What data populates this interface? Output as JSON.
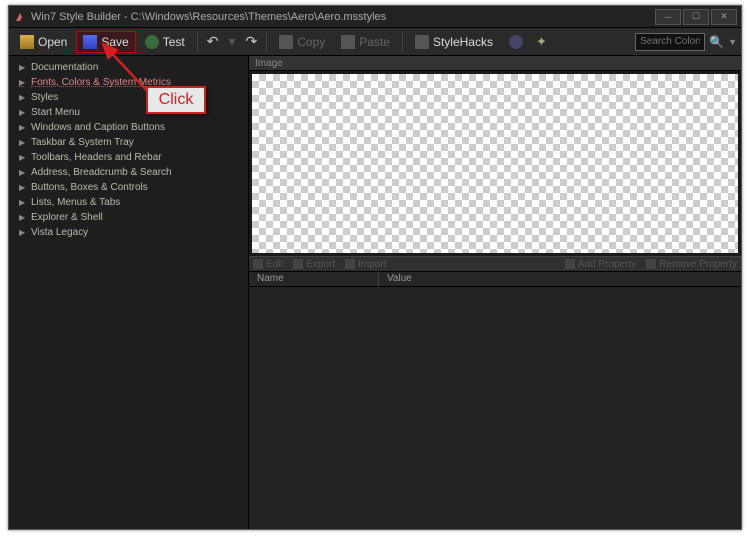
{
  "window": {
    "title": "Win7 Style Builder - C:\\Windows\\Resources\\Themes\\Aero\\Aero.msstyles"
  },
  "toolbar": {
    "open": "Open",
    "save": "Save",
    "test": "Test",
    "copy": "Copy",
    "paste": "Paste",
    "stylehacks": "StyleHacks"
  },
  "search": {
    "placeholder": "Search Colors"
  },
  "tree": {
    "items": [
      {
        "label": "Documentation",
        "hl": false
      },
      {
        "label": "Fonts, Colors & System Metrics",
        "hl": true
      },
      {
        "label": "Styles",
        "hl": false
      },
      {
        "label": "Start Menu",
        "hl": false
      },
      {
        "label": "Windows and Caption Buttons",
        "hl": false
      },
      {
        "label": "Taskbar & System Tray",
        "hl": false
      },
      {
        "label": "Toolbars, Headers and Rebar",
        "hl": false
      },
      {
        "label": "Address, Breadcrumb & Search",
        "hl": false
      },
      {
        "label": "Buttons, Boxes & Controls",
        "hl": false
      },
      {
        "label": "Lists, Menus & Tabs",
        "hl": false
      },
      {
        "label": "Explorer & Shell",
        "hl": false
      },
      {
        "label": "Vista Legacy",
        "hl": false
      }
    ]
  },
  "panels": {
    "image": "Image"
  },
  "propbar": {
    "edit": "Edit",
    "export": "Export",
    "import": "Import",
    "add": "Add Property",
    "remove": "Remove Property"
  },
  "propcols": {
    "name": "Name",
    "value": "Value"
  },
  "annotation": {
    "label": "Click"
  }
}
